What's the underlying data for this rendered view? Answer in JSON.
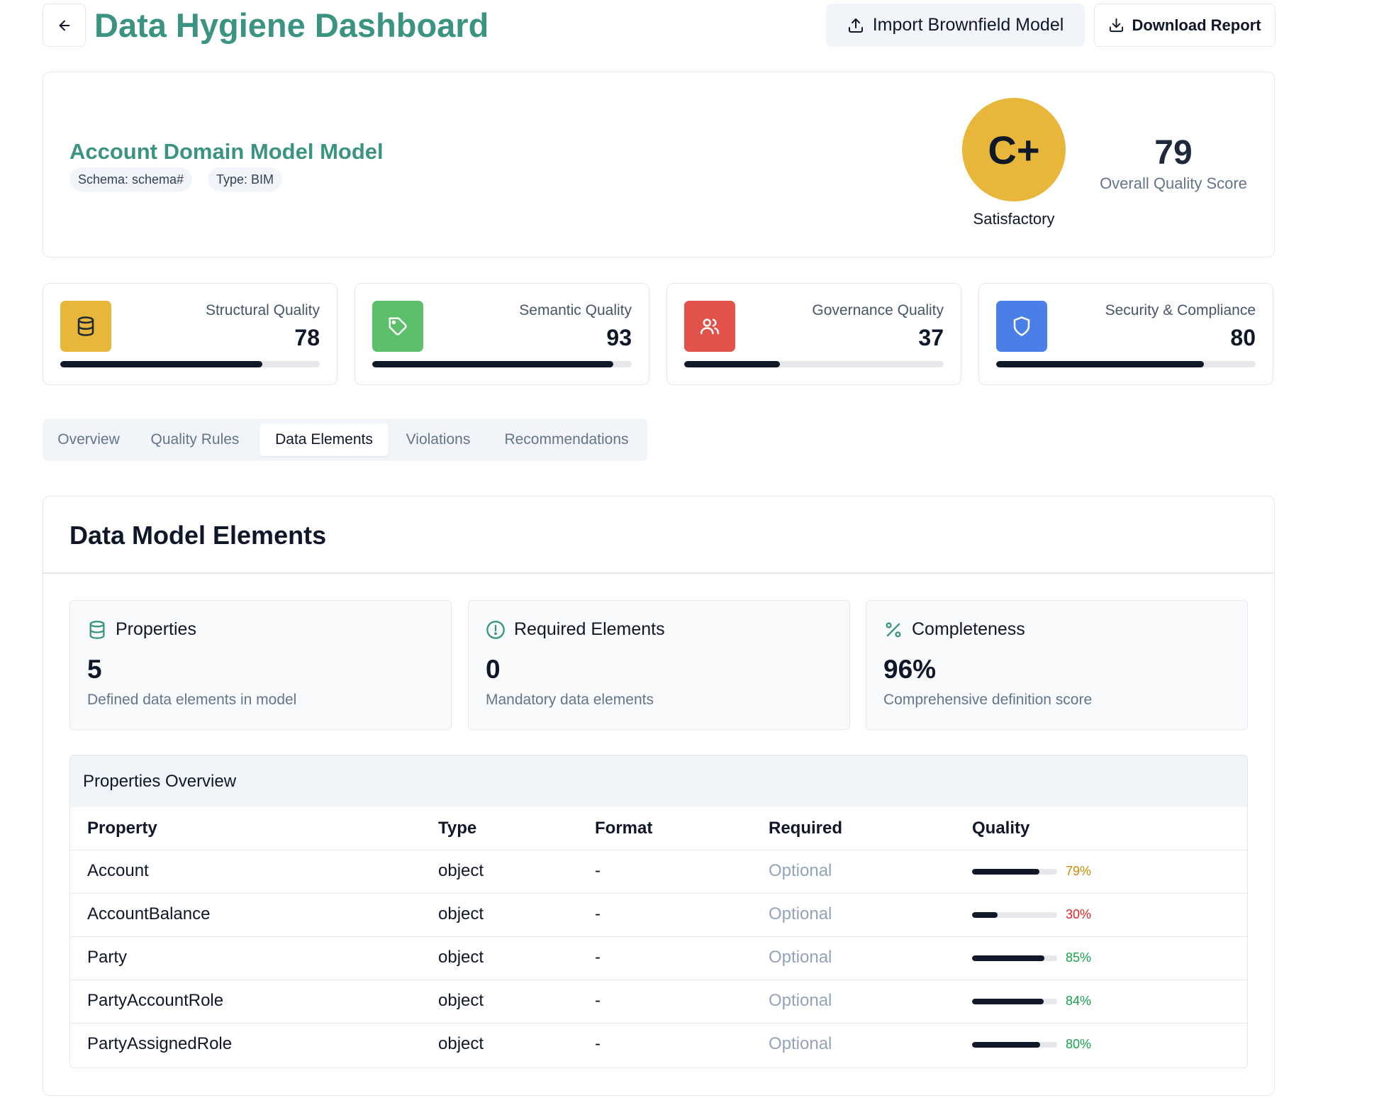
{
  "header": {
    "title": "Data Hygiene Dashboard",
    "import_label": "Import Brownfield Model",
    "download_label": "Download Report"
  },
  "model": {
    "name": "Account Domain Model Model",
    "schema": "Schema: schema#",
    "type": "Type: BIM",
    "grade": "C+",
    "grade_label": "Satisfactory",
    "grade_color": "#e7b63a",
    "score": "79",
    "score_label": "Overall Quality Score"
  },
  "metrics": [
    {
      "label": "Structural Quality",
      "value": "78",
      "percent": 78,
      "icon": "database-icon",
      "color": "#e7b63a"
    },
    {
      "label": "Semantic Quality",
      "value": "93",
      "percent": 93,
      "icon": "tag-icon",
      "color": "#5cbf6a"
    },
    {
      "label": "Governance Quality",
      "value": "37",
      "percent": 37,
      "icon": "users-icon",
      "color": "#e0524a"
    },
    {
      "label": "Security & Compliance",
      "value": "80",
      "percent": 80,
      "icon": "shield-icon",
      "color": "#4a7fe8"
    }
  ],
  "tabs": [
    {
      "label": "Overview",
      "active": false
    },
    {
      "label": "Quality Rules",
      "active": false
    },
    {
      "label": "Data Elements",
      "active": true
    },
    {
      "label": "Violations",
      "active": false
    },
    {
      "label": "Recommendations",
      "active": false
    }
  ],
  "elements": {
    "title": "Data Model Elements",
    "stats": [
      {
        "label": "Properties",
        "value": "5",
        "sub": "Defined data elements in model",
        "icon": "database-icon"
      },
      {
        "label": "Required Elements",
        "value": "0",
        "sub": "Mandatory data elements",
        "icon": "alert-circle-icon"
      },
      {
        "label": "Completeness",
        "value": "96%",
        "sub": "Comprehensive definition score",
        "icon": "percent-icon"
      }
    ],
    "accent_color": "#3b9482"
  },
  "table": {
    "caption": "Properties Overview",
    "headers": [
      "Property",
      "Type",
      "Format",
      "Required",
      "Quality"
    ],
    "rows": [
      {
        "property": "Account",
        "type": "object",
        "format": "-",
        "required": "Optional",
        "quality": 79,
        "quality_text": "79%",
        "quality_color": "#ca8a04"
      },
      {
        "property": "AccountBalance",
        "type": "object",
        "format": "-",
        "required": "Optional",
        "quality": 30,
        "quality_text": "30%",
        "quality_color": "#dc2626"
      },
      {
        "property": "Party",
        "type": "object",
        "format": "-",
        "required": "Optional",
        "quality": 85,
        "quality_text": "85%",
        "quality_color": "#16a34a"
      },
      {
        "property": "PartyAccountRole",
        "type": "object",
        "format": "-",
        "required": "Optional",
        "quality": 84,
        "quality_text": "84%",
        "quality_color": "#16a34a"
      },
      {
        "property": "PartyAssignedRole",
        "type": "object",
        "format": "-",
        "required": "Optional",
        "quality": 80,
        "quality_text": "80%",
        "quality_color": "#16a34a"
      }
    ]
  }
}
